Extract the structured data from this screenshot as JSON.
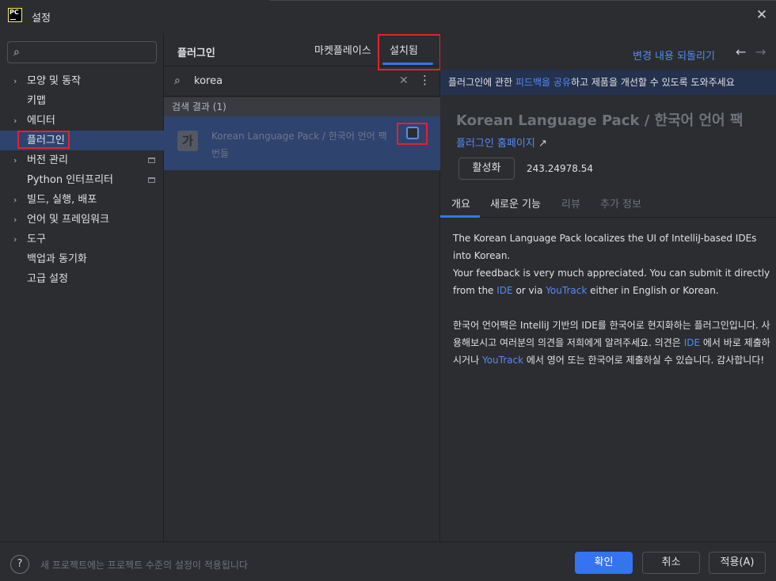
{
  "window": {
    "title": "설정",
    "logo_text": "PC"
  },
  "sidebar": {
    "search_placeholder": "",
    "items": [
      {
        "label": "모양 및 동작",
        "expandable": true
      },
      {
        "label": "키맵",
        "expandable": false
      },
      {
        "label": "에디터",
        "expandable": true
      },
      {
        "label": "플러그인",
        "expandable": false,
        "selected": true
      },
      {
        "label": "버전 관리",
        "expandable": true,
        "badge": true
      },
      {
        "label": "Python 인터프리터",
        "expandable": false,
        "badge": true
      },
      {
        "label": "빌드, 실행, 배포",
        "expandable": true
      },
      {
        "label": "언어 및 프레임워크",
        "expandable": true
      },
      {
        "label": "도구",
        "expandable": true
      },
      {
        "label": "백업과 동기화",
        "expandable": false
      },
      {
        "label": "고급 설정",
        "expandable": false
      }
    ]
  },
  "plugins": {
    "title": "플러그인",
    "tabs": {
      "marketplace": "마켓플레이스",
      "installed": "설치됨"
    },
    "search_query": "korea",
    "results_label": "검색 결과 (1)",
    "result": {
      "icon_text": "가",
      "name": "Korean Language Pack / 한국어 언어 팩",
      "sub": "번들",
      "enabled": false
    }
  },
  "detail": {
    "revert_label": "변경 내용 되돌리기",
    "banner": {
      "before": "플러그인에 관한 ",
      "link": "피드백을 공유",
      "after": "하고 제품을 개선할 수 있도록 도와주세요"
    },
    "title": "Korean Language Pack / 한국어 언어 팩",
    "homepage": "플러그인 홈페이지",
    "enable_label": "활성화",
    "version": "243.24978.54",
    "tabs": [
      "개요",
      "새로운 기능",
      "리뷰",
      "추가 정보"
    ],
    "desc": {
      "p1_a": "The Korean Language Pack localizes the UI of IntelliJ-based IDEs into Korean.",
      "p1_b": "Your feedback is very much appreciated. You can submit it directly from the",
      "ide": "IDE",
      "or_via": "or via",
      "youtrack": "YouTrack",
      "p1_c": "either in English or Korean.",
      "p2_a": "한국어 언어팩은 IntelliJ 기반의 IDE를 한국어로 현지화하는 플러그인입니다. 사용해보시고 여러분의 의견을 저희에게 알려주세요. 의견은",
      "p2_ide": "IDE",
      "p2_b": "에서 바로 제출하시거나",
      "p2_yt": "YouTrack",
      "p2_c": "에서 영어 또는 한국어로 제출하실 수 있습니다. 감사합니다!"
    }
  },
  "footer": {
    "help": "?",
    "hint": "새 프로젝트에는 프로젝트 수준의 설정이 적용됩니다",
    "ok": "확인",
    "cancel": "취소",
    "apply": "적용(A)"
  },
  "colors": {
    "accent": "#3574f0",
    "selection": "#2e436e",
    "highlight_box": "#e5212d",
    "link": "#548af7"
  }
}
